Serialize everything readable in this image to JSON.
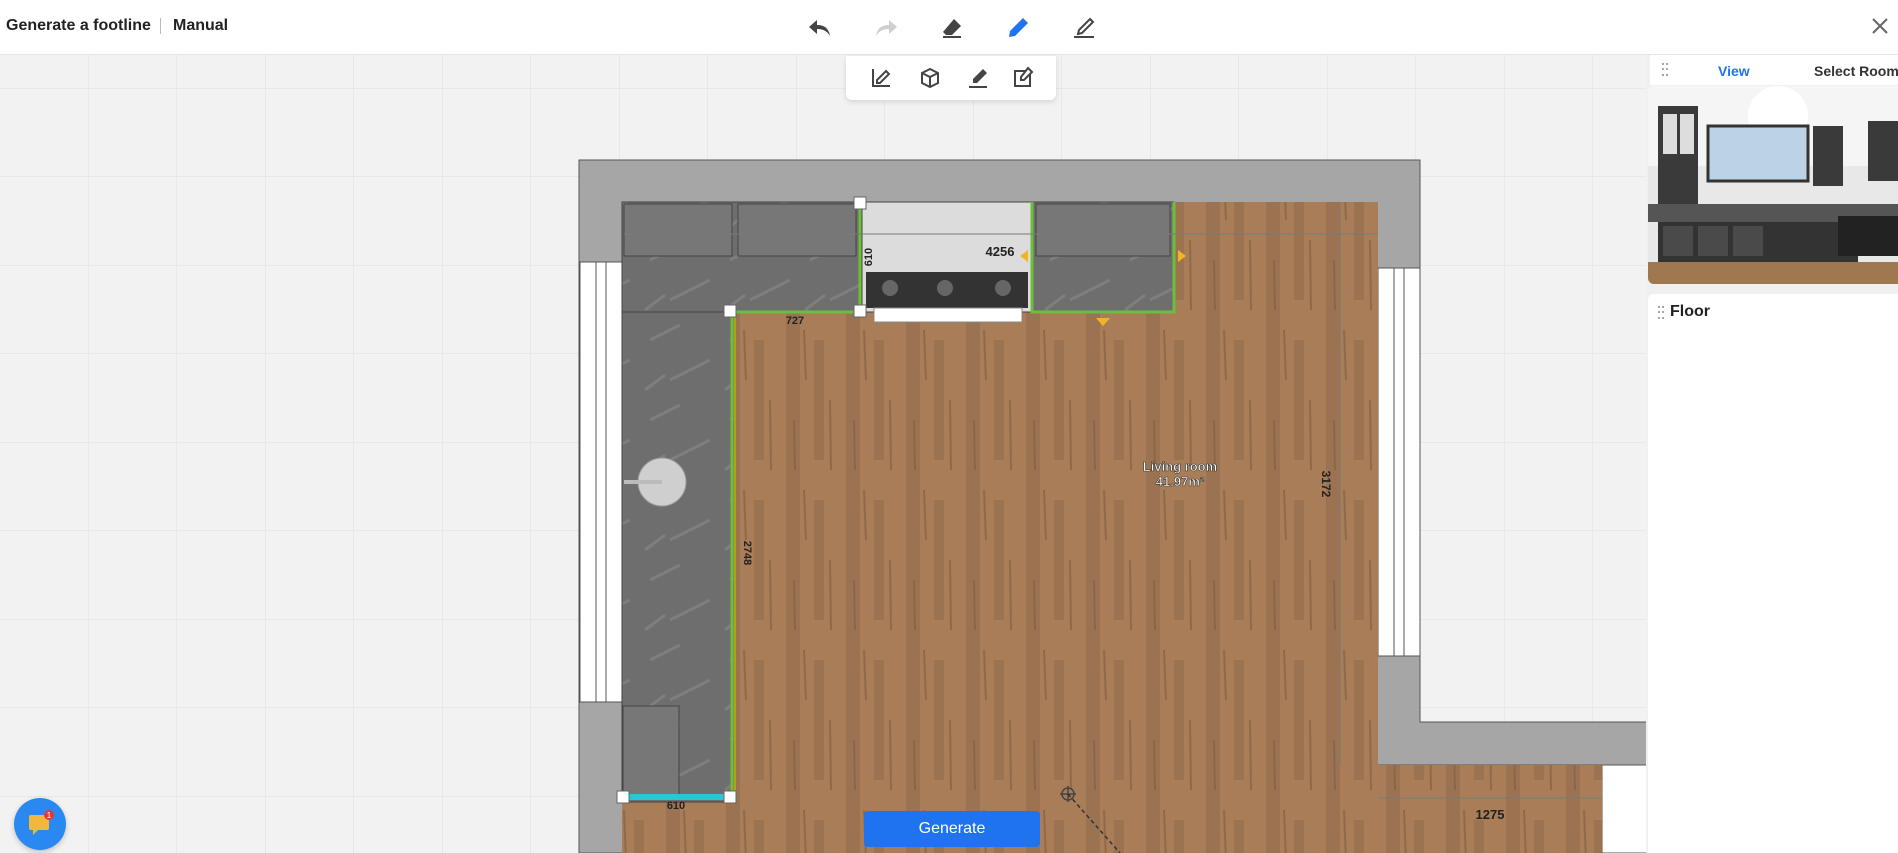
{
  "header": {
    "title": "Generate a footline",
    "mode": "Manual"
  },
  "toolbar": {
    "tools": [
      "undo-icon",
      "redo-icon",
      "eraser-icon",
      "pencil-icon",
      "line-edit-icon"
    ],
    "sub_tools": [
      "draw-line-icon",
      "cube-icon",
      "brush-icon",
      "edit-box-icon"
    ]
  },
  "panel": {
    "tab_view": "View",
    "tab_select_room": "Select Room",
    "floor_title": "Floor"
  },
  "plan": {
    "room_name": "Living room",
    "room_area": "41.97m²",
    "dims": {
      "top": "4256",
      "left_depth": "610",
      "counter": "727",
      "left_run": "2748",
      "right_side": "3172",
      "bottom_left": "610",
      "bottom_right": "1275"
    }
  },
  "actions": {
    "generate_label": "Generate"
  },
  "chat": {
    "badge_count": "1"
  },
  "colors": {
    "accent": "#1f73ee",
    "wall": "#a6a6a6",
    "floor": "#a87d57",
    "outline_green": "#6bbf3a",
    "highlight_cyan": "#29c5d9",
    "marker": "#f0b429"
  }
}
